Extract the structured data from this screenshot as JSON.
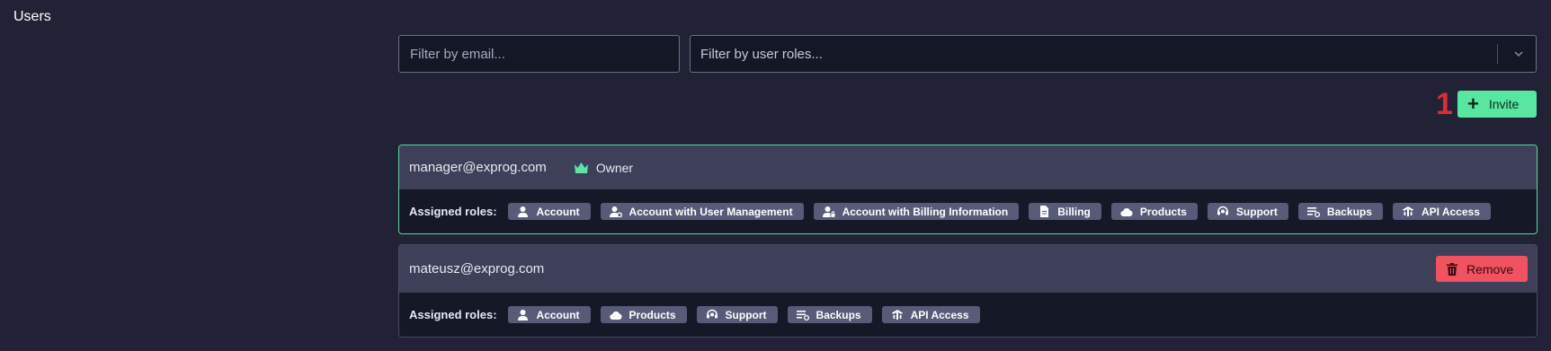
{
  "page": {
    "title": "Users"
  },
  "filters": {
    "email_placeholder": "Filter by email...",
    "roles_placeholder": "Filter by user roles..."
  },
  "annotation": {
    "number": "1",
    "color": "#e02b35"
  },
  "invite_button": {
    "label": "Invite",
    "icon": "plus-icon",
    "color": "#58e7a1"
  },
  "users": [
    {
      "email": "manager@exprog.com",
      "badge": {
        "label": "Owner",
        "icon": "crown-icon",
        "color": "#58e7a1"
      },
      "assigned_label": "Assigned roles:",
      "roles": [
        {
          "label": "Account",
          "icon": "user-icon"
        },
        {
          "label": "Account with User Management",
          "icon": "user-gear-icon"
        },
        {
          "label": "Account with Billing Information",
          "icon": "user-lock-icon"
        },
        {
          "label": "Billing",
          "icon": "document-icon"
        },
        {
          "label": "Products",
          "icon": "cloud-icon"
        },
        {
          "label": "Support",
          "icon": "headset-icon"
        },
        {
          "label": "Backups",
          "icon": "backup-list-icon"
        },
        {
          "label": "API Access",
          "icon": "api-icon"
        }
      ]
    },
    {
      "email": "mateusz@exprog.com",
      "remove_button": {
        "label": "Remove",
        "icon": "trash-icon",
        "color": "#f0525f"
      },
      "assigned_label": "Assigned roles:",
      "roles": [
        {
          "label": "Account",
          "icon": "user-icon"
        },
        {
          "label": "Products",
          "icon": "cloud-icon"
        },
        {
          "label": "Support",
          "icon": "headset-icon"
        },
        {
          "label": "Backups",
          "icon": "backup-list-icon"
        },
        {
          "label": "API Access",
          "icon": "api-icon"
        }
      ]
    }
  ]
}
